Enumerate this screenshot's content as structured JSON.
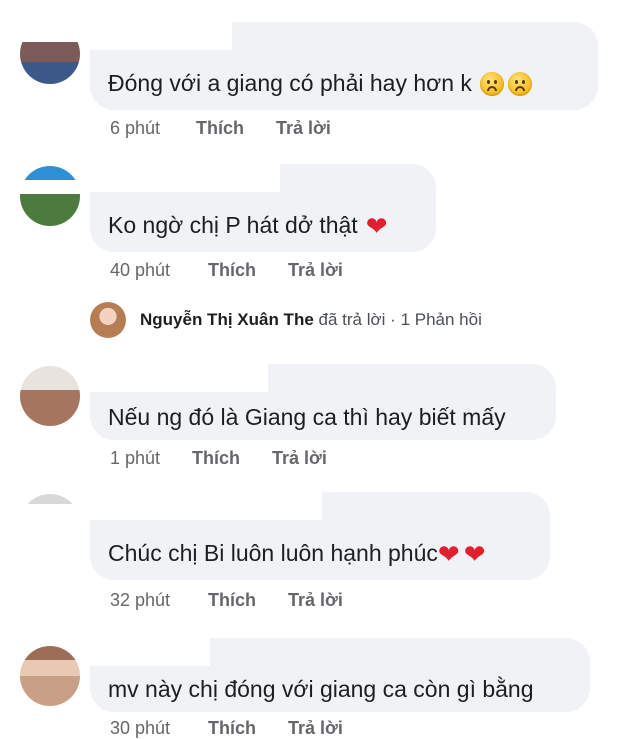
{
  "comments": [
    {
      "text": "Đóng với a giang có phải hay hơn k",
      "emojis": [
        "sad-face",
        "sad-face"
      ],
      "time": "6 phút",
      "like": "Thích",
      "reply": "Trả lời"
    },
    {
      "text": "Ko ngờ chị P hát dở thật",
      "emojis": [
        "heart"
      ],
      "time": "40 phút",
      "like": "Thích",
      "reply": "Trả lời"
    },
    {
      "text": "Nếu ng đó là Giang ca thì hay biết mấy",
      "emojis": [],
      "time": "1 phút",
      "like": "Thích",
      "reply": "Trả lời"
    },
    {
      "text": "Chúc chị Bi luôn luôn hạnh phúc",
      "emojis": [
        "heart",
        "heart"
      ],
      "time": "32 phút",
      "like": "Thích",
      "reply": "Trả lời"
    },
    {
      "text": "mv này chị đóng với giang ca còn gì bằng",
      "emojis": [],
      "time": "30 phút",
      "like": "Thích",
      "reply": "Trả lời"
    }
  ],
  "reply_row": {
    "name": "Nguyễn Thị Xuân The",
    "action": "đã trả lời",
    "separator": "·",
    "count": "1 Phản hồi"
  },
  "colors": {
    "bubble": "#f0f2f5",
    "text": "#1c1e21",
    "meta": "#65676b",
    "heart": "#e0202e"
  }
}
